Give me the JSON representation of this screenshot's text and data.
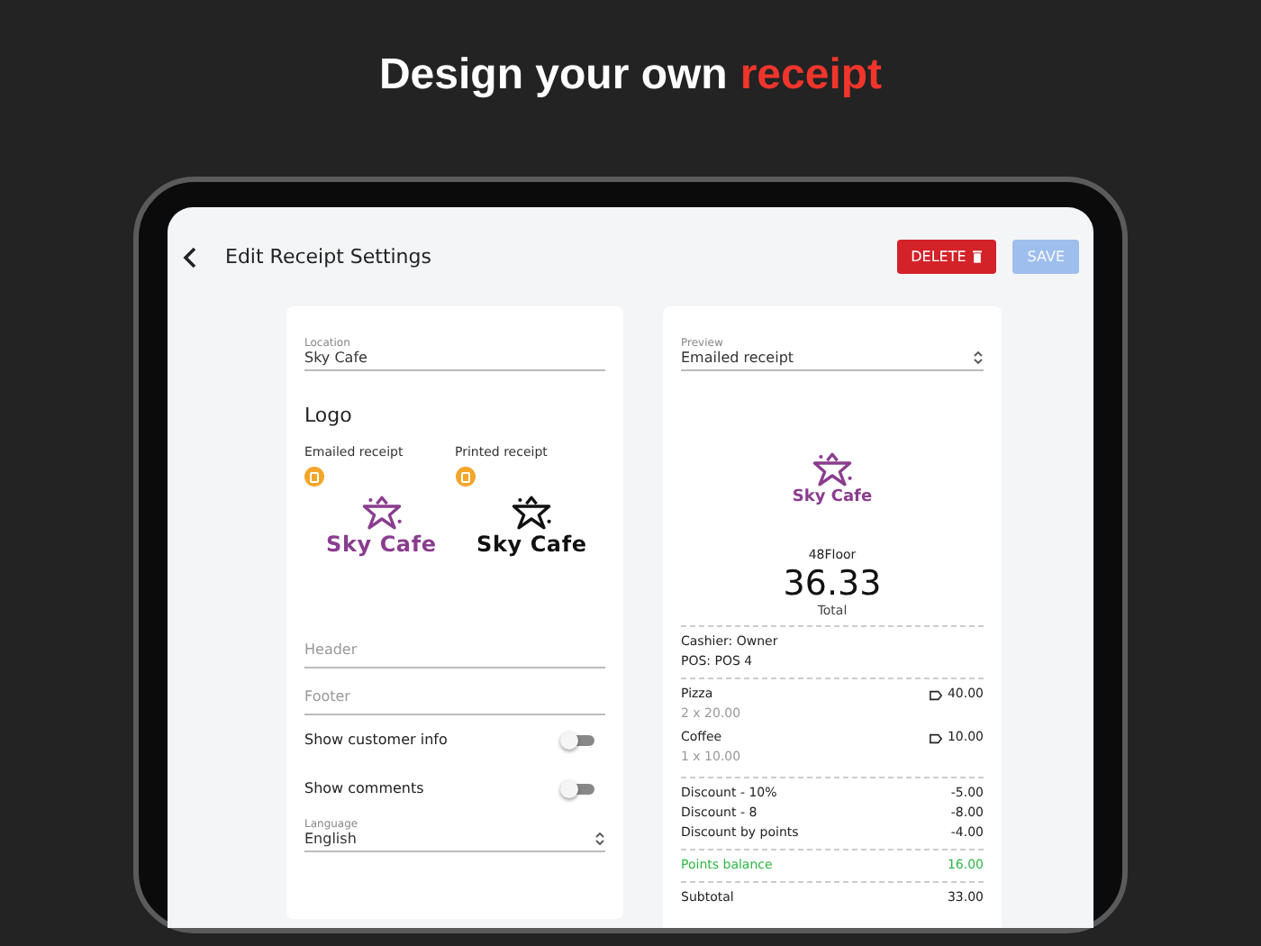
{
  "headline": {
    "text": "Design your own",
    "highlight": "receipt"
  },
  "topbar": {
    "title": "Edit Receipt Settings",
    "buttons": [
      {
        "label": "DELETE",
        "kind": "danger",
        "disabled": false
      },
      {
        "label": "SAVE",
        "kind": "primary",
        "disabled": true
      }
    ]
  },
  "settings": {
    "location": {
      "label": "Location",
      "value": "Sky Cafe"
    },
    "logo_title": "Logo",
    "logos": [
      {
        "label": "Emailed receipt",
        "text": "Sky Cafe",
        "color": "#8a3d8f"
      },
      {
        "label": "Printed receipt",
        "text": "Sky Cafe",
        "color": "#111111"
      }
    ],
    "fields": [
      {
        "placeholder": "Header"
      },
      {
        "placeholder": "Footer"
      }
    ],
    "toggles": [
      {
        "label": "Show customer info",
        "on": false
      },
      {
        "label": "Show comments",
        "on": false
      }
    ],
    "language": {
      "label": "Language",
      "value": "English"
    }
  },
  "preview": {
    "select": {
      "label": "Preview",
      "value": "Emailed receipt"
    },
    "logo": {
      "text": "Sky Cafe",
      "color": "#8a3d8f"
    },
    "store": "48Floor",
    "total": "36.33",
    "total_label": "Total",
    "sections": [
      [
        {
          "kind": "text",
          "text": "Cashier: Owner"
        },
        {
          "kind": "text",
          "text": "POS: POS 4"
        }
      ],
      [
        {
          "kind": "item",
          "name": "Pizza",
          "detail": "2 x 20.00",
          "amount": "40.00"
        },
        {
          "kind": "item",
          "name": "Coffee",
          "detail": "1 x 10.00",
          "amount": "10.00"
        }
      ],
      [
        {
          "kind": "line",
          "name": "Discount - 10%",
          "amount": "-5.00"
        },
        {
          "kind": "line",
          "name": "Discount - 8",
          "amount": "-8.00"
        },
        {
          "kind": "line",
          "name": "Discount by points",
          "amount": "-4.00"
        }
      ],
      [
        {
          "kind": "points",
          "name": "Points balance",
          "amount": "16.00"
        }
      ],
      [
        {
          "kind": "line",
          "name": "Subtotal",
          "amount": "33.00"
        }
      ]
    ]
  }
}
